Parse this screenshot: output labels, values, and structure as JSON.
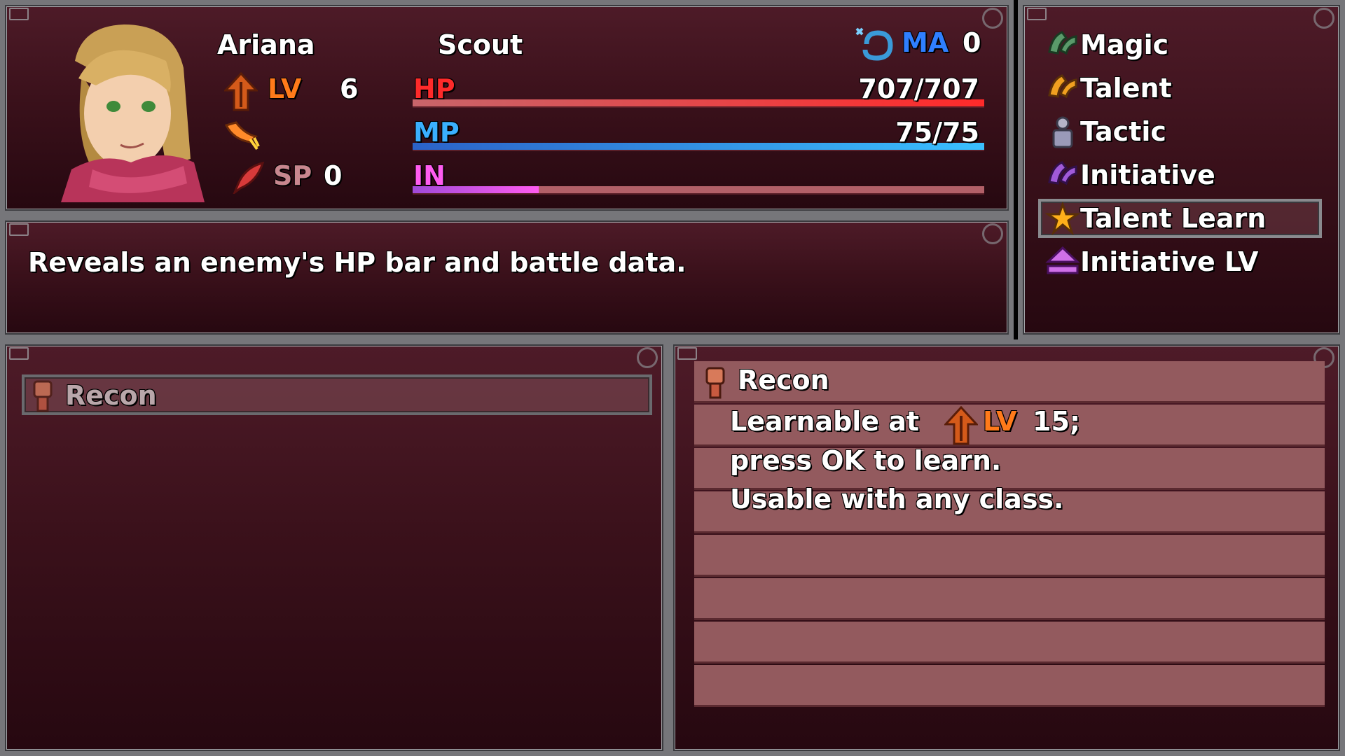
{
  "actor": {
    "name": "Ariana",
    "class": "Scout",
    "level_label": "LV",
    "level": "6",
    "sp_label": "SP",
    "sp": "0",
    "ma_label": "MA",
    "ma": "0",
    "hp_label": "HP",
    "hp": "707/707",
    "hp_fraction": 1.0,
    "mp_label": "MP",
    "mp": "75/75",
    "mp_fraction": 1.0,
    "in_label": "IN",
    "in_fraction": 0.22
  },
  "menu": {
    "items": [
      {
        "label": "Magic",
        "icon": "magic-claw-icon"
      },
      {
        "label": "Talent",
        "icon": "talent-claw-icon"
      },
      {
        "label": "Tactic",
        "icon": "tactic-figure-icon"
      },
      {
        "label": "Initiative",
        "icon": "initiative-claw-icon"
      },
      {
        "label": "Talent Learn",
        "icon": "star-person-icon",
        "selected": true
      },
      {
        "label": "Initiative LV",
        "icon": "eject-up-icon"
      }
    ]
  },
  "help": {
    "text": "Reveals an enemy's HP bar and battle data."
  },
  "skill_list": {
    "items": [
      {
        "label": "Recon",
        "icon": "fist-icon"
      }
    ]
  },
  "detail": {
    "title": "Recon",
    "line1_pre": "Learnable at",
    "line1_lv": "LV",
    "line1_post": "15;",
    "line2": "press OK to learn.",
    "line3": "Usable with any class."
  },
  "colors": {
    "hp_label": "#ff2a2a",
    "mp_label": "#3ab0ff",
    "in_label": "#ff5cf0",
    "lv_label": "#ff7a1a",
    "ma_label": "#2f7fff",
    "sp_label": "#c8878f"
  }
}
